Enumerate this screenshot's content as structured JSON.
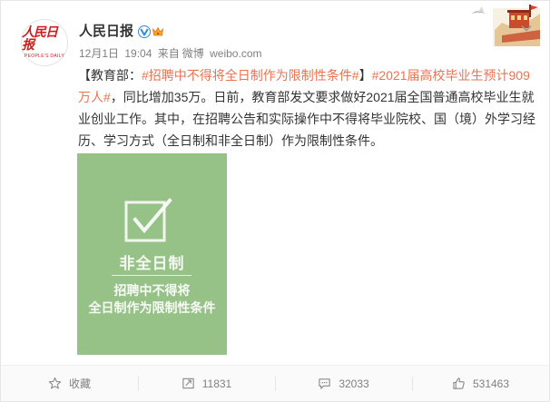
{
  "user": {
    "name": "人民日报",
    "avatar_logo": "人民日报",
    "avatar_logo_en": "PEOPLE'S DAILY"
  },
  "meta": {
    "date": "12月1日",
    "time": "19:04",
    "from_prefix": "来自",
    "source": "微博",
    "domain": "weibo.com"
  },
  "post": {
    "prefix": "【教育部：",
    "tag1": "#招聘中不得将全日制作为限制性条件#",
    "mid": "】",
    "tag2": "#2021届高校毕业生预计909万人#",
    "body": "，同比增加35万。日前，教育部发文要求做好2021届全国普通高校毕业生就业创业工作。其中，在招聘公告和实际操作中不得将毕业院校、国（境）外学习经历、学习方式（全日制和非全日制）作为限制性条件。"
  },
  "image": {
    "label_main": "非全日制",
    "label_line1": "招聘中不得将",
    "label_line2": "全日制作为限制性条件",
    "background_color": "#97c287"
  },
  "actions": [
    {
      "name": "favorite",
      "label": "收藏",
      "icon": "star-icon"
    },
    {
      "name": "repost",
      "label": "11831",
      "icon": "repost-icon"
    },
    {
      "name": "comment",
      "label": "32033",
      "icon": "comment-icon"
    },
    {
      "name": "like",
      "label": "531463",
      "icon": "thumbs-up-icon"
    }
  ],
  "colors": {
    "tag": "#eb7350",
    "meta": "#808080",
    "verified": "#f6a623"
  }
}
